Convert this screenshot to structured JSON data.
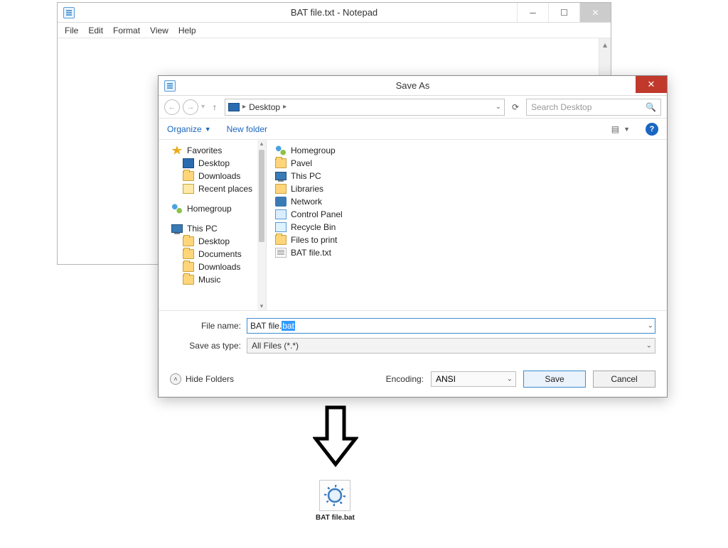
{
  "notepad": {
    "title": "BAT file.txt - Notepad",
    "menu": {
      "file": "File",
      "edit": "Edit",
      "format": "Format",
      "view": "View",
      "help": "Help"
    }
  },
  "saveas": {
    "title": "Save As",
    "breadcrumb": {
      "location": "Desktop"
    },
    "search_placeholder": "Search Desktop",
    "toolbar": {
      "organize": "Organize",
      "newfolder": "New folder"
    },
    "tree": {
      "favorites": "Favorites",
      "fav_items": {
        "desktop": "Desktop",
        "downloads": "Downloads",
        "recent": "Recent places"
      },
      "homegroup": "Homegroup",
      "thispc": "This PC",
      "pc_items": {
        "desktop": "Desktop",
        "documents": "Documents",
        "downloads": "Downloads",
        "music": "Music"
      }
    },
    "list": {
      "homegroup": "Homegroup",
      "pavel": "Pavel",
      "thispc": "This PC",
      "libraries": "Libraries",
      "network": "Network",
      "controlpanel": "Control Panel",
      "recycle": "Recycle Bin",
      "filestoprint": "Files to print",
      "batfile": "BAT file.txt"
    },
    "fields": {
      "filename_label": "File name:",
      "filename_prefix": "BAT file.",
      "filename_selected": "bat",
      "savetype_label": "Save as type:",
      "savetype_value": "All Files  (*.*)"
    },
    "footer": {
      "hidefolders": "Hide Folders",
      "encoding_label": "Encoding:",
      "encoding_value": "ANSI",
      "save": "Save",
      "cancel": "Cancel"
    }
  },
  "result": {
    "filename": "BAT file.bat"
  }
}
